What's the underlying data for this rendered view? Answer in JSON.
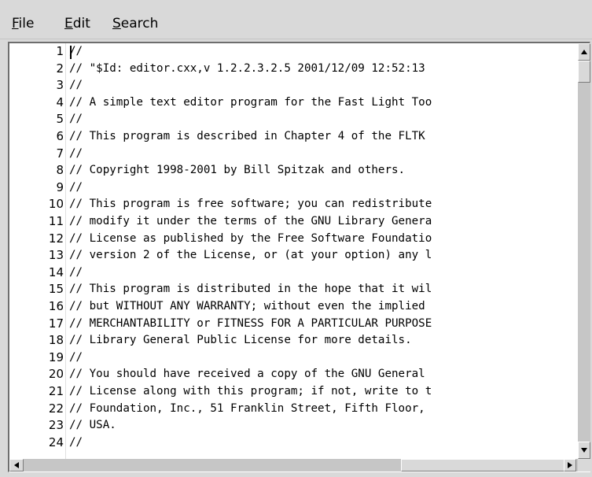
{
  "menu": {
    "items": [
      {
        "label": "File",
        "mnemonic": "F",
        "rest": "ile"
      },
      {
        "label": "Edit",
        "mnemonic": "E",
        "rest": "dit"
      },
      {
        "label": "Search",
        "mnemonic": "S",
        "rest": "earch"
      }
    ]
  },
  "editor": {
    "lines": [
      {
        "num": "1",
        "text": "//"
      },
      {
        "num": "2",
        "text": "// \"$Id: editor.cxx,v 1.2.2.3.2.5 2001/12/09 12:52:13"
      },
      {
        "num": "3",
        "text": "//"
      },
      {
        "num": "4",
        "text": "// A simple text editor program for the Fast Light Too"
      },
      {
        "num": "5",
        "text": "//"
      },
      {
        "num": "6",
        "text": "// This program is described in Chapter 4 of the FLTK"
      },
      {
        "num": "7",
        "text": "//"
      },
      {
        "num": "8",
        "text": "// Copyright 1998-2001 by Bill Spitzak and others."
      },
      {
        "num": "9",
        "text": "//"
      },
      {
        "num": "10",
        "text": "// This program is free software; you can redistribute"
      },
      {
        "num": "11",
        "text": "// modify it under the terms of the GNU Library Genera"
      },
      {
        "num": "12",
        "text": "// License as published by the Free Software Foundatio"
      },
      {
        "num": "13",
        "text": "// version 2 of the License, or (at your option) any l"
      },
      {
        "num": "14",
        "text": "//"
      },
      {
        "num": "15",
        "text": "// This program is distributed in the hope that it wil"
      },
      {
        "num": "16",
        "text": "// but WITHOUT ANY WARRANTY; without even the implied"
      },
      {
        "num": "17",
        "text": "// MERCHANTABILITY or FITNESS FOR A PARTICULAR PURPOSE"
      },
      {
        "num": "18",
        "text": "// Library General Public License for more details."
      },
      {
        "num": "19",
        "text": "//"
      },
      {
        "num": "20",
        "text": "// You should have received a copy of the GNU General"
      },
      {
        "num": "21",
        "text": "// License along with this program; if not, write to t"
      },
      {
        "num": "22",
        "text": "// Foundation, Inc., 51 Franklin Street, Fifth Floor,"
      },
      {
        "num": "23",
        "text": "// USA."
      },
      {
        "num": "24",
        "text": "//"
      }
    ]
  },
  "icons": {
    "scroll_up": "arrow-up-icon",
    "scroll_down": "arrow-down-icon",
    "scroll_left": "arrow-left-icon",
    "scroll_right": "arrow-right-icon"
  }
}
